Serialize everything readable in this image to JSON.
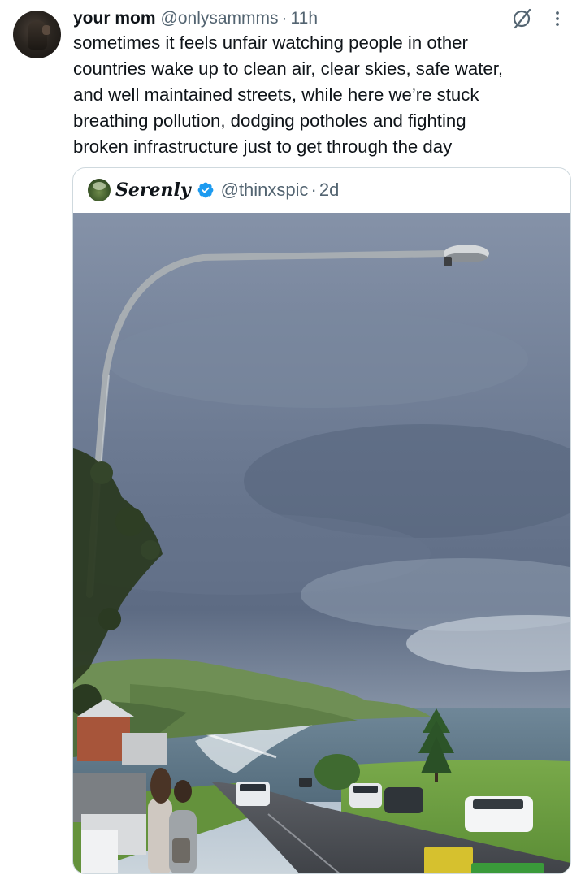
{
  "tweet": {
    "display_name": "your mom",
    "handle": "@onlysammms",
    "separator": "·",
    "time": "11h",
    "text_lines": [
      "sometimes it feels unfair watching people in other",
      "countries wake up to clean air, clear skies, safe water,",
      "and well maintained streets, while here we’re stuck",
      "breathing pollution, dodging potholes and fighting",
      "broken infrastructure just to get through the day"
    ],
    "icons": {
      "grok": "grok-icon",
      "more": "more-vertical-icon"
    }
  },
  "quoted": {
    "display_name": "Serenly",
    "verified": true,
    "handle": "@thinxspic",
    "separator": "·",
    "time": "2d",
    "photo": "street-lamp-coastal-view-photo"
  },
  "colors": {
    "text_primary": "#0f1419",
    "text_secondary": "#536471",
    "border": "#cfd9de",
    "verified_blue": "#1d9bf0"
  }
}
